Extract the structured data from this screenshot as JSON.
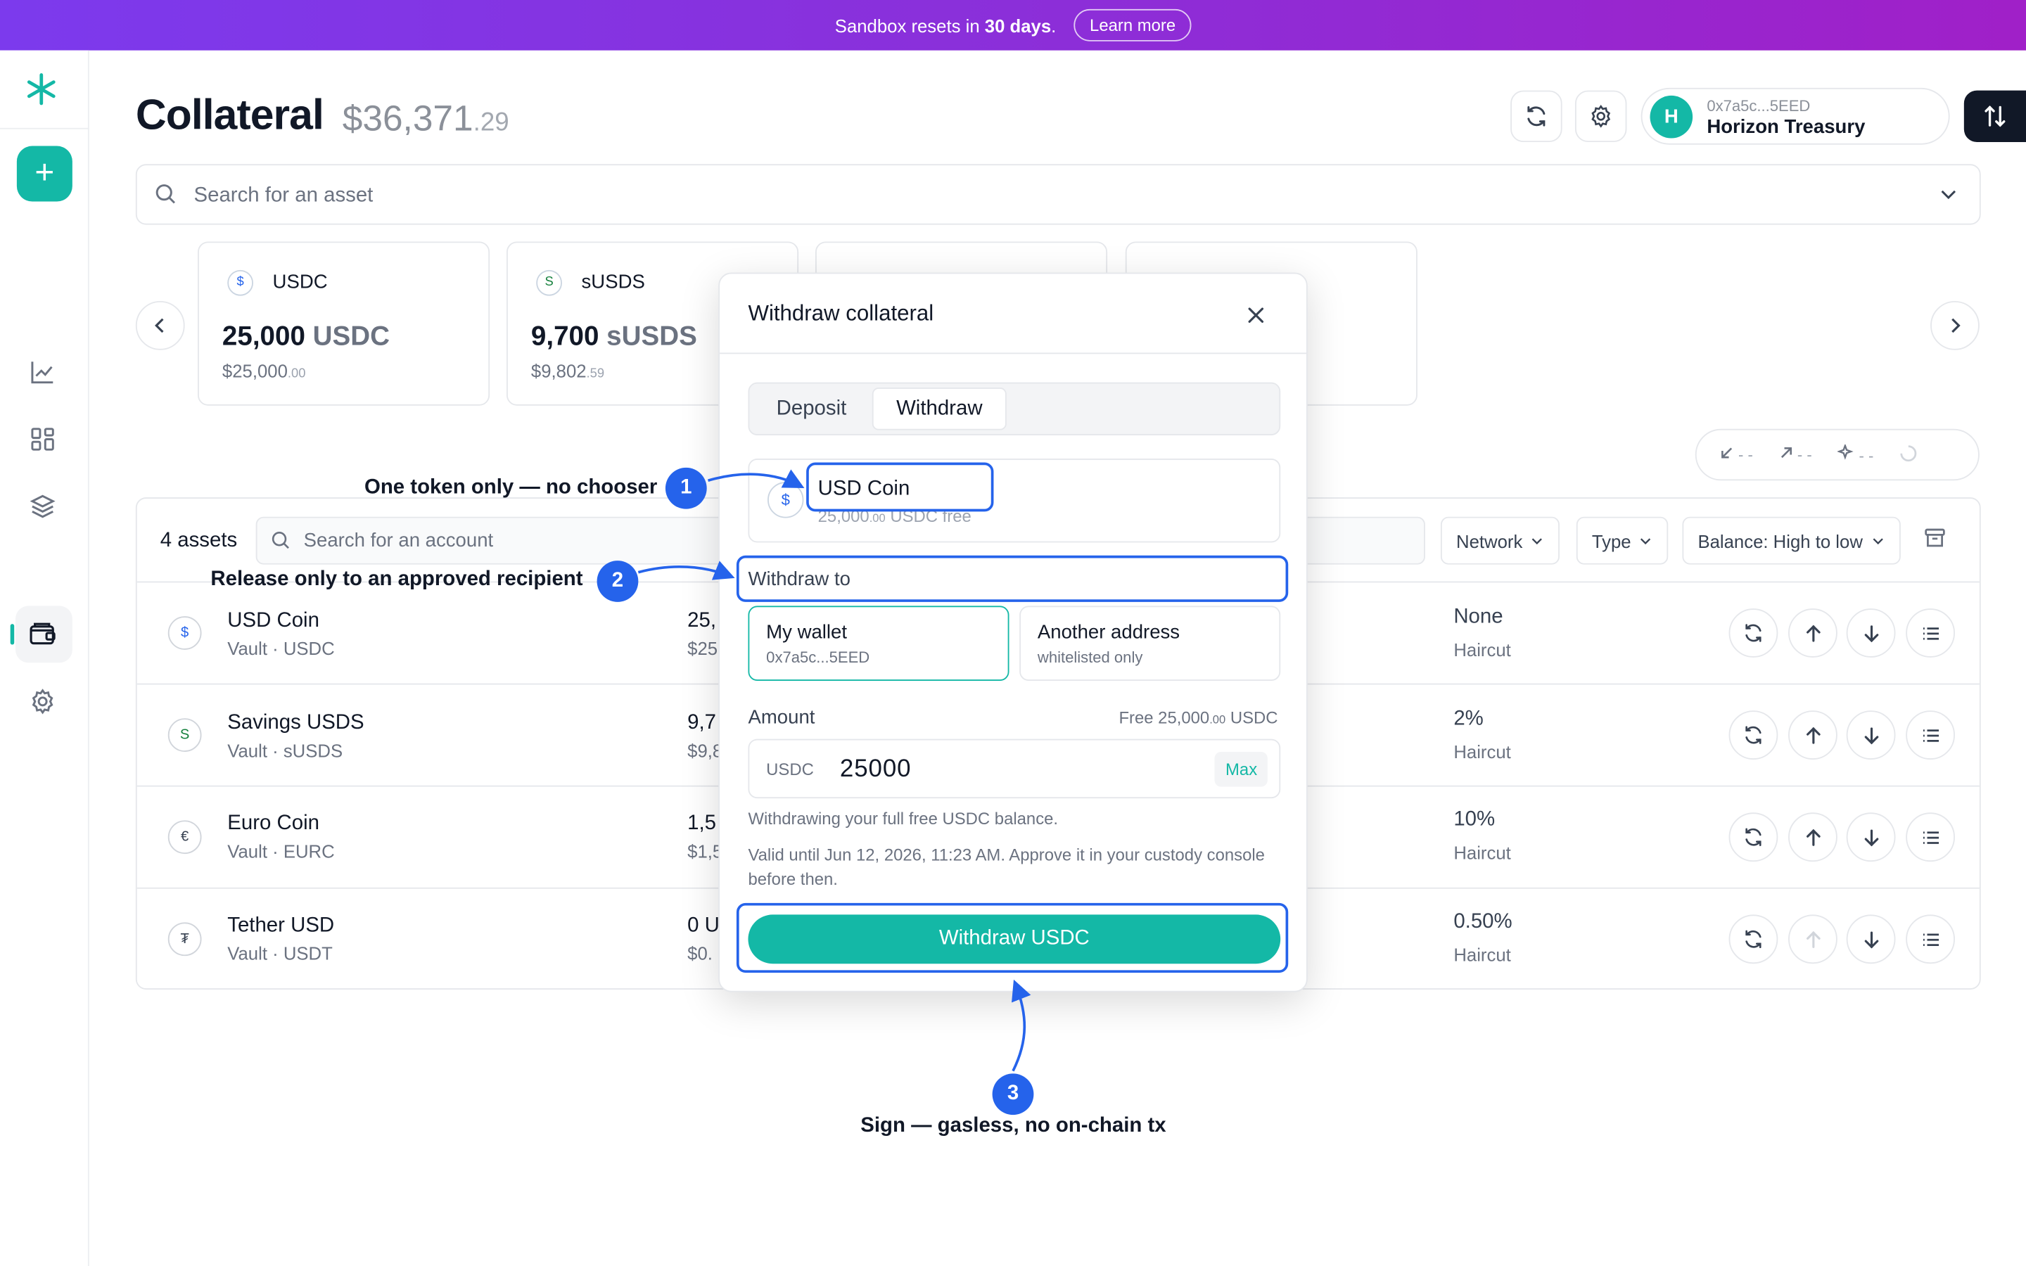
{
  "banner": {
    "text_prefix": "Sandbox resets in",
    "days": "30 days",
    "text_suffix": ".",
    "learn_more": "Learn more"
  },
  "sidebar": {
    "logo": "asterisk-logo",
    "add_label": "+",
    "items": [
      "chart-icon",
      "grid-icon",
      "layers-icon",
      "wallet-icon",
      "gear-icon"
    ],
    "active": "wallet-icon"
  },
  "header": {
    "title": "Collateral",
    "total_main": "$36,371",
    "total_cents": ".29",
    "account_address": "0x7a5c...5EED",
    "account_name": "Horizon Treasury",
    "avatar_initial": "H"
  },
  "search": {
    "placeholder": "Search for an asset"
  },
  "cards": [
    {
      "icon": "$",
      "name": "USDC",
      "amount": "25,000",
      "unit": "USDC",
      "usd_main": "$25,000",
      "usd_cents": ".00"
    },
    {
      "icon": "S",
      "name": "sUSDS",
      "amount": "9,700",
      "unit": "sUSDS",
      "usd_main": "$9,802",
      "usd_cents": ".59"
    }
  ],
  "stats": {
    "in": "- -",
    "out": "- -",
    "sparkle": "- -"
  },
  "table": {
    "count": "4 assets",
    "search_placeholder": "Search for an account",
    "filters": [
      "Network",
      "Type",
      "Balance: High to low"
    ],
    "rows": [
      {
        "icon": "$",
        "name": "USD Coin",
        "sub": "Vault · USDC",
        "bal": "25,",
        "bal_usd": "$25",
        "haircut": "None",
        "haircut_label": "Haircut"
      },
      {
        "icon": "S",
        "name": "Savings USDS",
        "sub": "Vault · sUSDS",
        "bal": "9,7",
        "bal_usd": "$9,8",
        "haircut": "2%",
        "haircut_label": "Haircut"
      },
      {
        "icon": "€",
        "name": "Euro Coin",
        "sub": "Vault · EURC",
        "bal": "1,5",
        "bal_usd": "$1,5",
        "haircut": "10%",
        "haircut_label": "Haircut"
      },
      {
        "icon": "₮",
        "name": "Tether USD",
        "sub": "Vault · USDT",
        "bal": "0 U",
        "bal_usd": "$0.",
        "haircut": "0.50%",
        "haircut_label": "Haircut"
      }
    ]
  },
  "modal": {
    "title": "Withdraw collateral",
    "tabs": [
      "Deposit",
      "Withdraw"
    ],
    "active_tab": "Withdraw",
    "token": {
      "icon": "$",
      "name": "USD Coin",
      "free_main": "25,000",
      "free_cents": ".00",
      "free_suffix": "USDC free"
    },
    "withdraw_to_label": "Withdraw to",
    "options": [
      {
        "label": "My wallet",
        "sub": "0x7a5c...5EED",
        "selected": true
      },
      {
        "label": "Another address",
        "sub": "whitelisted only",
        "selected": false
      }
    ],
    "amount_label": "Amount",
    "amount_free_prefix": "Free 25,000",
    "amount_free_cents": ".00",
    "amount_free_unit": "USDC",
    "amount_currency": "USDC",
    "amount_value": "25000",
    "max_label": "Max",
    "note1": "Withdrawing your full free USDC balance.",
    "note2": "Valid until Jun 12, 2026, 11:23 AM. Approve it in your custody console before then.",
    "submit": "Withdraw USDC"
  },
  "annotations": [
    {
      "number": "1",
      "text": "One token only — no chooser"
    },
    {
      "number": "2",
      "text": "Release only to an approved recipient"
    },
    {
      "number": "3",
      "text": "Sign — gasless, no on-chain tx"
    }
  ],
  "colors": {
    "accent": "#14b8a6",
    "annotation": "#2563eb",
    "banner_start": "#7c3aed",
    "banner_end": "#a020c8"
  }
}
